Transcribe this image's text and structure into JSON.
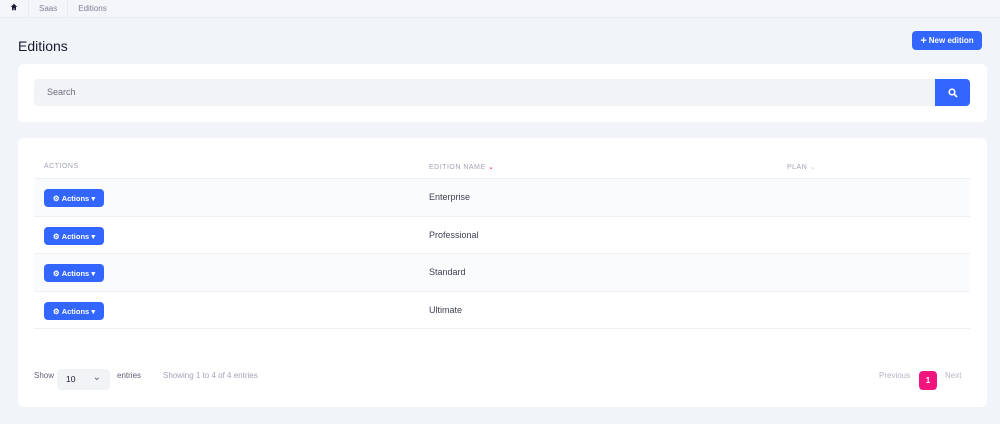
{
  "breadcrumb": {
    "items": [
      "Saas",
      "Editions"
    ]
  },
  "page": {
    "title": "Editions",
    "new_button": "New edition"
  },
  "search": {
    "placeholder": "Search"
  },
  "table": {
    "headers": {
      "actions": "ACTIONS",
      "edition_name": "EDITION NAME",
      "plan": "PLAN"
    },
    "action_label": "Actions",
    "rows": [
      {
        "name": "Enterprise"
      },
      {
        "name": "Professional"
      },
      {
        "name": "Standard"
      },
      {
        "name": "Ultimate"
      }
    ]
  },
  "footer": {
    "show": "Show",
    "page_size": "10",
    "entries": "entries",
    "info": "Showing 1 to 4 of 4 entries",
    "previous": "Previous",
    "current_page": "1",
    "next": "Next"
  },
  "colors": {
    "primary": "#3366ff",
    "accent": "#f1157e"
  }
}
